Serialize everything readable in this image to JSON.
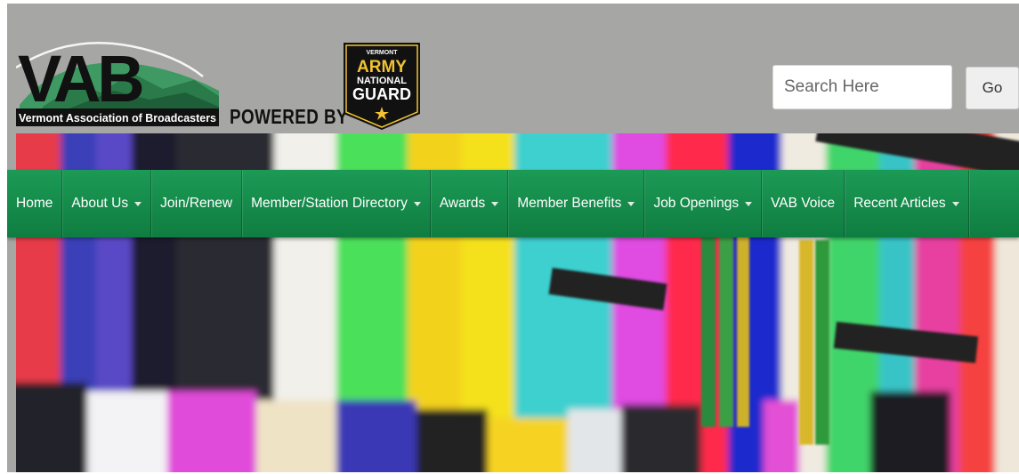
{
  "header": {
    "logo": {
      "acronym": "VAB",
      "name": "Vermont Association of Broadcasters"
    },
    "powered_by": "POWERED BY",
    "sponsor": {
      "top": "VERMONT",
      "line1": "ARMY",
      "line2": "NATIONAL",
      "line3": "GUARD"
    }
  },
  "search": {
    "placeholder": "Search Here",
    "button": "Go"
  },
  "nav": {
    "items": [
      {
        "label": "Home",
        "dropdown": false
      },
      {
        "label": "About Us",
        "dropdown": true
      },
      {
        "label": "Join/Renew",
        "dropdown": false
      },
      {
        "label": "Member/Station Directory",
        "dropdown": true
      },
      {
        "label": "Awards",
        "dropdown": true
      },
      {
        "label": "Member Benefits",
        "dropdown": true
      },
      {
        "label": "Job Openings",
        "dropdown": true
      },
      {
        "label": "VAB Voice",
        "dropdown": false
      },
      {
        "label": "Recent Articles",
        "dropdown": true
      }
    ]
  },
  "colors": {
    "header_bg": "#a6a6a4",
    "nav_green": "#14894a",
    "logo_green": "#2f8f5a",
    "guard_gold": "#f2c233"
  }
}
